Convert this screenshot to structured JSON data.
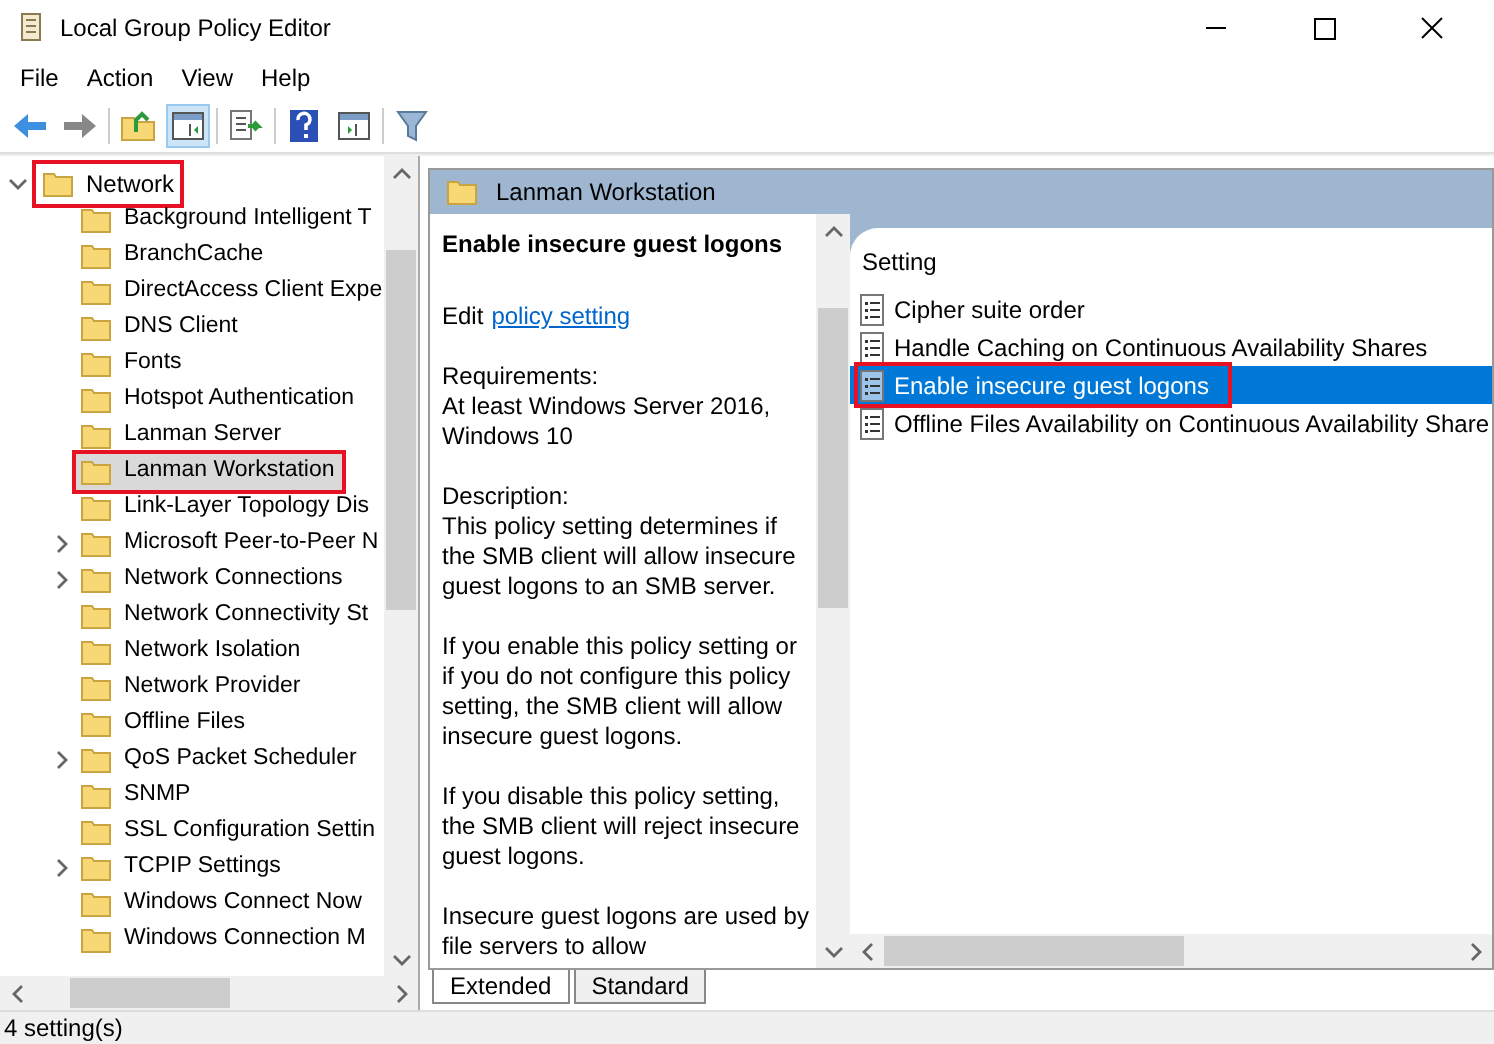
{
  "window": {
    "title": "Local Group Policy Editor"
  },
  "menu": [
    "File",
    "Action",
    "View",
    "Help"
  ],
  "tree": {
    "label": "Network",
    "expanded": true,
    "annotated": true,
    "children": [
      {
        "label": "Background Intelligent T",
        "expandable": false,
        "selected": false,
        "annotated": false
      },
      {
        "label": "BranchCache",
        "expandable": false,
        "selected": false,
        "annotated": false
      },
      {
        "label": "DirectAccess Client Expe",
        "expandable": false,
        "selected": false,
        "annotated": false
      },
      {
        "label": "DNS Client",
        "expandable": false,
        "selected": false,
        "annotated": false
      },
      {
        "label": "Fonts",
        "expandable": false,
        "selected": false,
        "annotated": false
      },
      {
        "label": "Hotspot Authentication",
        "expandable": false,
        "selected": false,
        "annotated": false
      },
      {
        "label": "Lanman Server",
        "expandable": false,
        "selected": false,
        "annotated": false
      },
      {
        "label": "Lanman Workstation",
        "expandable": false,
        "selected": true,
        "annotated": true
      },
      {
        "label": "Link-Layer Topology Dis",
        "expandable": false,
        "selected": false,
        "annotated": false
      },
      {
        "label": "Microsoft Peer-to-Peer N",
        "expandable": true,
        "selected": false,
        "annotated": false
      },
      {
        "label": "Network Connections",
        "expandable": true,
        "selected": false,
        "annotated": false
      },
      {
        "label": "Network Connectivity St",
        "expandable": false,
        "selected": false,
        "annotated": false
      },
      {
        "label": "Network Isolation",
        "expandable": false,
        "selected": false,
        "annotated": false
      },
      {
        "label": "Network Provider",
        "expandable": false,
        "selected": false,
        "annotated": false
      },
      {
        "label": "Offline Files",
        "expandable": false,
        "selected": false,
        "annotated": false
      },
      {
        "label": "QoS Packet Scheduler",
        "expandable": true,
        "selected": false,
        "annotated": false
      },
      {
        "label": "SNMP",
        "expandable": false,
        "selected": false,
        "annotated": false
      },
      {
        "label": "SSL Configuration Settin",
        "expandable": false,
        "selected": false,
        "annotated": false
      },
      {
        "label": "TCPIP Settings",
        "expandable": true,
        "selected": false,
        "annotated": false
      },
      {
        "label": "Windows Connect Now",
        "expandable": false,
        "selected": false,
        "annotated": false
      },
      {
        "label": "Windows Connection M",
        "expandable": false,
        "selected": false,
        "annotated": false
      }
    ]
  },
  "header": {
    "title": "Lanman Workstation"
  },
  "description": {
    "title": "Enable insecure guest logons",
    "edit_prefix": "Edit",
    "edit_link": "policy setting",
    "paragraphs": [
      [
        "Requirements:",
        "At least Windows Server 2016,",
        "Windows 10"
      ],
      [
        "Description:",
        "This policy setting determines if",
        "the SMB client will allow insecure",
        "guest logons to an SMB server."
      ],
      [
        "If you enable this policy setting or",
        "if you do not configure this policy",
        "setting, the SMB client will allow",
        "insecure guest logons."
      ],
      [
        "If you disable this policy setting,",
        "the SMB client will reject insecure",
        "guest logons."
      ],
      [
        "Insecure guest logons are used by",
        "file servers to allow"
      ]
    ]
  },
  "settings": {
    "column": "Setting",
    "rows": [
      {
        "name": "Cipher suite order",
        "selected": false,
        "annotated": false
      },
      {
        "name": "Handle Caching on Continuous Availability Shares",
        "selected": false,
        "annotated": false
      },
      {
        "name": "Enable insecure guest logons",
        "selected": true,
        "annotated": true
      },
      {
        "name": "Offline Files Availability on Continuous Availability Share",
        "selected": false,
        "annotated": false
      }
    ]
  },
  "tabs": [
    {
      "label": "Extended",
      "selected": true
    },
    {
      "label": "Standard",
      "selected": false
    }
  ],
  "status_bar": "4 setting(s)"
}
